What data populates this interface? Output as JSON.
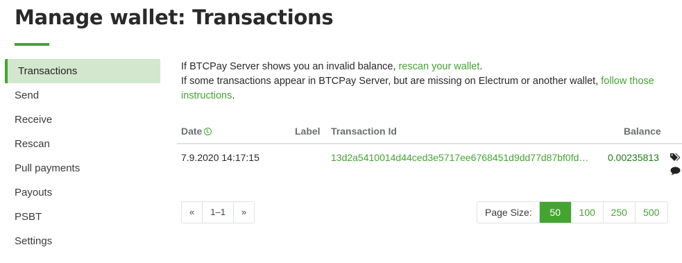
{
  "page": {
    "title": "Manage wallet: Transactions"
  },
  "sidebar": {
    "items": [
      {
        "label": "Transactions",
        "active": true
      },
      {
        "label": "Send"
      },
      {
        "label": "Receive"
      },
      {
        "label": "Rescan"
      },
      {
        "label": "Pull payments"
      },
      {
        "label": "Payouts"
      },
      {
        "label": "PSBT"
      },
      {
        "label": "Settings"
      }
    ]
  },
  "info": {
    "line1_prefix": "If BTCPay Server shows you an invalid balance, ",
    "line1_link": "rescan your wallet",
    "line1_suffix": ".",
    "line2_prefix": "If some transactions appear in BTCPay Server, but are missing on Electrum or another wallet, ",
    "line2_link": "follow those instructions",
    "line2_suffix": "."
  },
  "table": {
    "columns": {
      "date": "Date",
      "label": "Label",
      "txid": "Transaction Id",
      "balance": "Balance"
    },
    "rows": [
      {
        "date": "7.9.2020 14:17:15",
        "label": "",
        "txid": "13d2a5410014d44ced3e5717ee6768451d9dd77d87bf0fd…",
        "balance": "0.00235813"
      }
    ]
  },
  "pagination": {
    "prev": "«",
    "range": "1–1",
    "next": "»"
  },
  "page_size": {
    "label": "Page Size:",
    "options": [
      "50",
      "100",
      "250",
      "500"
    ],
    "selected": "50"
  },
  "icons": {
    "sort": "clock-sort-icon",
    "tag": "tag-icon",
    "comment": "comment-icon"
  },
  "colors": {
    "accent": "#44a431",
    "active_nav_bg": "#d2e7cd",
    "balance_positive": "#1f7a17"
  }
}
